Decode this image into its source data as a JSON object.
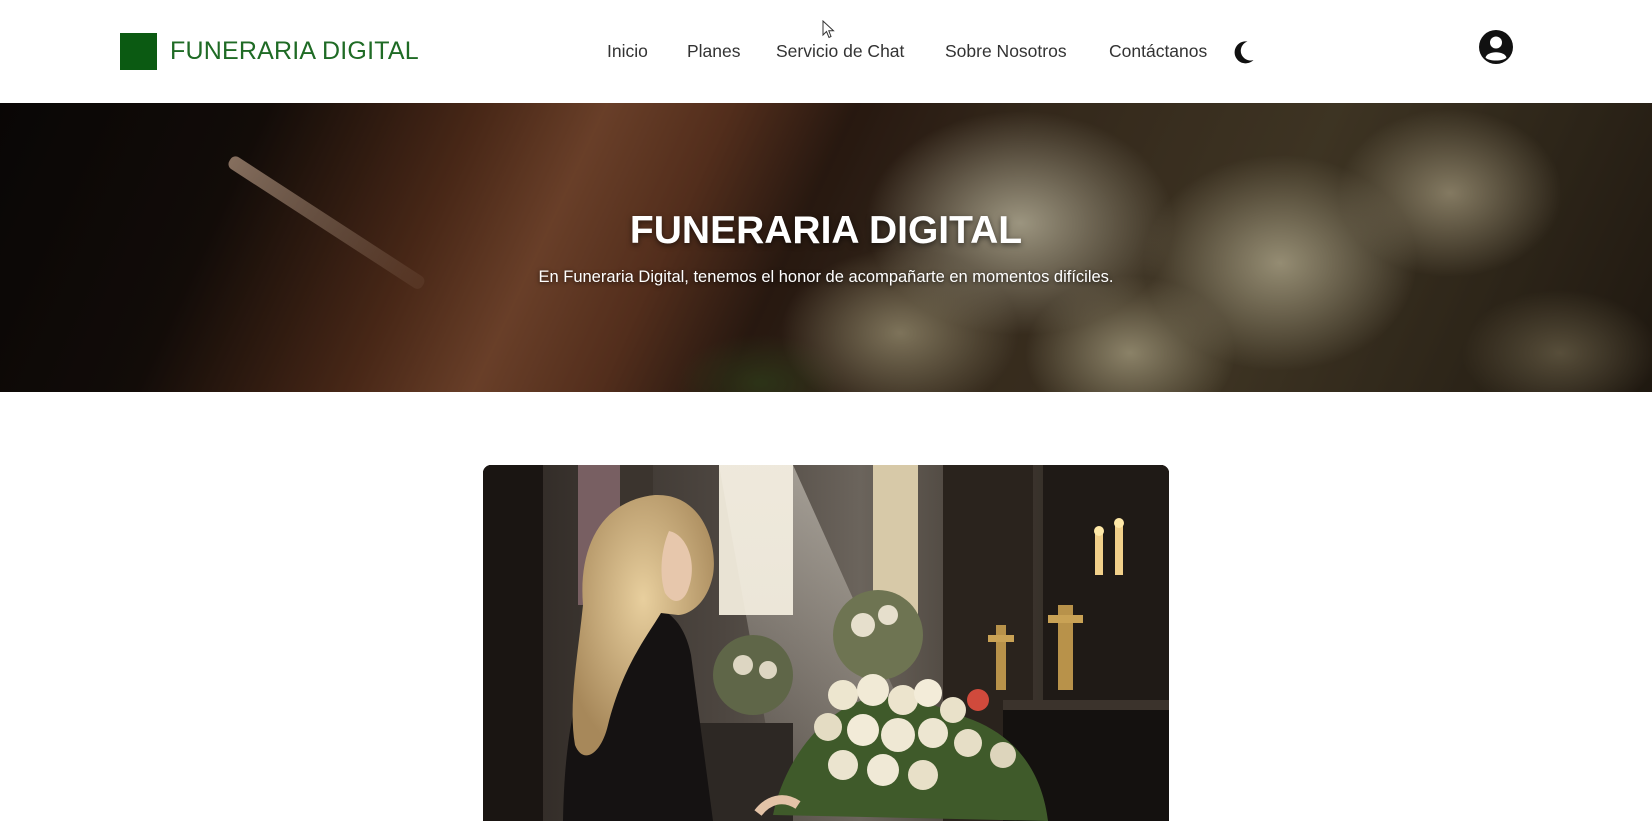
{
  "navbar": {
    "brand": {
      "name": "FUNERARIA DIGITAL",
      "logo_icon": "square-logo-icon",
      "logo_color": "#0b5a12"
    },
    "links": [
      {
        "label": "Inicio"
      },
      {
        "label": "Planes"
      },
      {
        "label": "Servicio de Chat"
      },
      {
        "label": "Sobre Nosotros"
      },
      {
        "label": "Contáctanos"
      }
    ],
    "theme_toggle_icon": "moon-icon",
    "user_icon": "user-circle-icon"
  },
  "hero": {
    "title": "FUNERARIA DIGITAL",
    "subtitle": "En Funeraria Digital, tenemos el honor de acompañarte en momentos difíciles."
  },
  "colors": {
    "brand_green": "#0b5a12",
    "brand_text": "#1f6b25",
    "nav_text": "#333333"
  }
}
